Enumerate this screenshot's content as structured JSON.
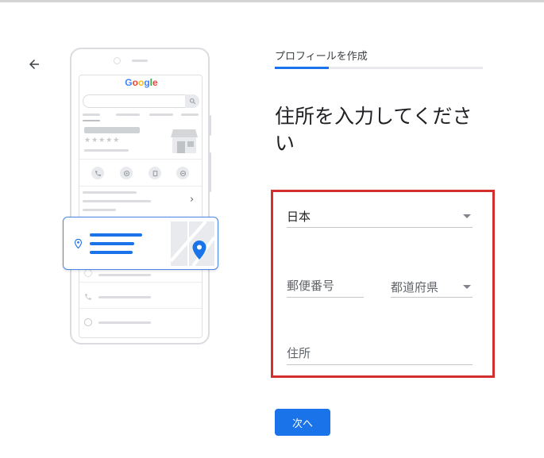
{
  "illustration": {
    "logo_text": "Google",
    "rating_stars": "★★★★★",
    "chevron": "›"
  },
  "form": {
    "step_label": "プロフィールを作成",
    "progress": 0.26,
    "heading": "住所を入力してください",
    "country_value": "日本",
    "postal_code_placeholder": "郵便番号",
    "prefecture_placeholder": "都道府県",
    "address_placeholder": "住所",
    "next_label": "次へ"
  },
  "colors": {
    "accent": "#1a73e8",
    "highlight_border": "#d32f2f"
  },
  "icons": [
    "back-arrow-icon",
    "phone-icon",
    "directions-icon",
    "save-icon",
    "share-icon",
    "location-pin-icon",
    "clock-icon",
    "globe-icon",
    "map-pin-icon",
    "dropdown-caret-icon"
  ]
}
